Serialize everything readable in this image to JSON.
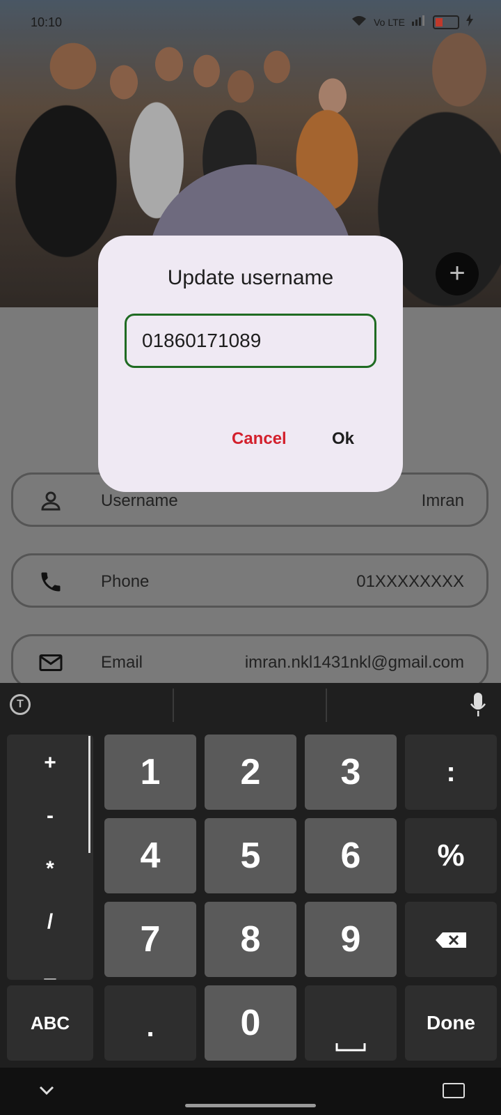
{
  "status_bar": {
    "time": "10:10",
    "network_label": "Vo LTE"
  },
  "profile": {
    "rows": [
      {
        "label": "Username",
        "value": "Imran"
      },
      {
        "label": "Phone",
        "value": "01XXXXXXXX"
      },
      {
        "label": "Email",
        "value": "imran.nkl1431nkl@gmail.com"
      }
    ],
    "add_button": "+"
  },
  "dialog": {
    "title": "Update username",
    "input_value": "01860171089",
    "cancel_label": "Cancel",
    "ok_label": "Ok"
  },
  "keyboard": {
    "symbols": [
      "+",
      "-",
      "*",
      "/",
      "_"
    ],
    "digits": [
      "1",
      "2",
      "3",
      "4",
      "5",
      "6",
      "7",
      "8",
      "9"
    ],
    "colon": ":",
    "percent": "%",
    "abc": "ABC",
    "dot": ".",
    "zero": "0",
    "done": "Done"
  },
  "colors": {
    "accent_green": "#1f6b22",
    "cancel_red": "#d3202c"
  }
}
